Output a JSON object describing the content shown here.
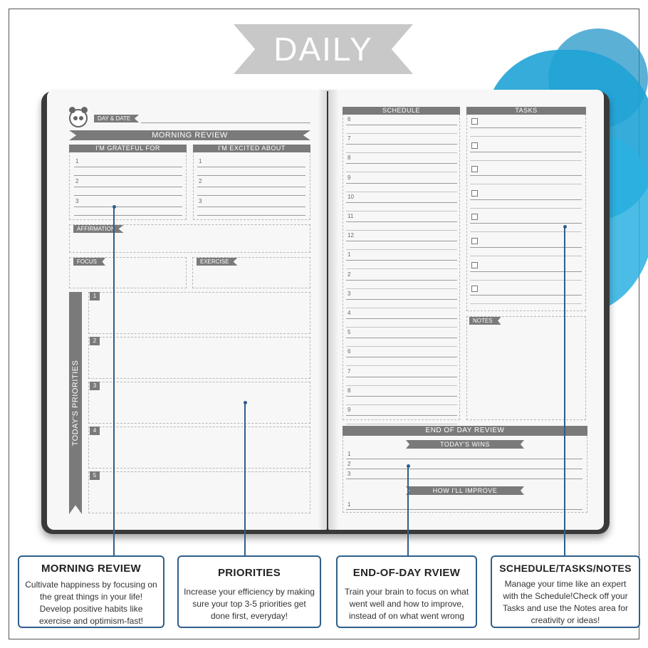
{
  "banner": {
    "title": "DAILY"
  },
  "left_page": {
    "day_date_label": "DAY & DATE",
    "morning_review_label": "MORNING REVIEW",
    "grateful_label": "I'M GRATEFUL FOR",
    "excited_label": "I'M EXCITED ABOUT",
    "grateful_numbers": [
      "1",
      "2",
      "3"
    ],
    "excited_numbers": [
      "1",
      "2",
      "3"
    ],
    "affirmation_label": "AFFIRMATION",
    "focus_label": "FOCUS",
    "exercise_label": "EXERCISE",
    "priorities_label": "TODAY'S PRIORITIES",
    "priority_numbers": [
      "1",
      "2",
      "3",
      "4",
      "5"
    ]
  },
  "right_page": {
    "schedule_label": "SCHEDULE",
    "tasks_label": "TASKS",
    "notes_label": "NOTES",
    "schedule_hours": [
      "6",
      "7",
      "8",
      "9",
      "10",
      "11",
      "12",
      "1",
      "2",
      "3",
      "4",
      "5",
      "6",
      "7",
      "8",
      "9"
    ],
    "end_of_day_label": "END OF DAY REVIEW",
    "todays_wins_label": "TODAY'S WINS",
    "wins_numbers": [
      "1",
      "2",
      "3"
    ],
    "improve_label": "HOW I'LL IMPROVE",
    "improve_numbers": [
      "1"
    ]
  },
  "callouts": {
    "morning": {
      "title": "MORNING REVIEW",
      "text": "Cultivate happiness by focusing on the great things in your life! Develop positive habits like exercise and optimism-fast!"
    },
    "priorities": {
      "title": "PRIORITIES",
      "text": "Increase your efficiency by making sure your top 3-5 priorities get done first, everyday!"
    },
    "end_of_day": {
      "title": "END-OF-DAY RVIEW",
      "text": "Train your brain to focus on what went well and how to improve, instead of on what went wrong"
    },
    "schedule": {
      "title": "SCHEDULE/TASKS/NOTES",
      "text": "Manage your time like an expert with the Schedule!Check off your Tasks and use the Notes area for creativity or ideas!"
    }
  },
  "colors": {
    "accent": "#2e5f8a",
    "splash": "#1fa3d6",
    "ribbon": "#c8c8c8",
    "label_bar": "#7a7a7a"
  }
}
